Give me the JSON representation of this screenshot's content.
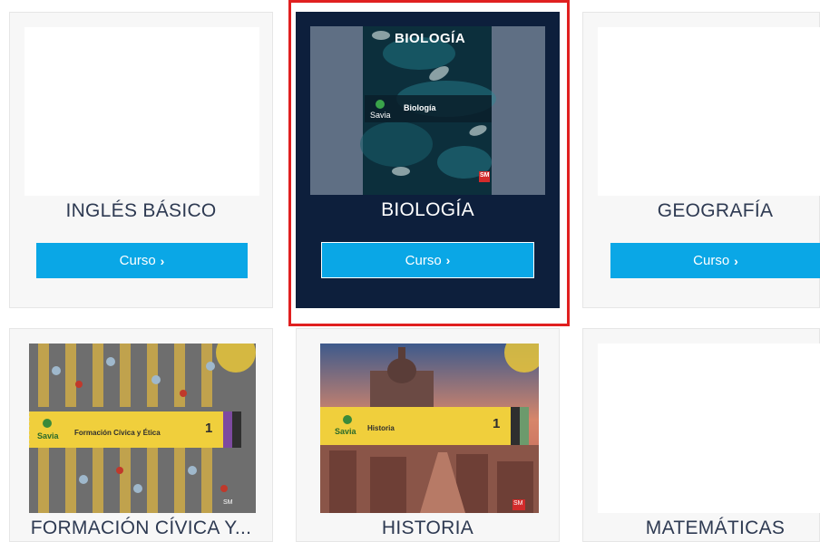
{
  "courses": [
    {
      "title": "INGLÉS BÁSICO",
      "button_label": "Curso",
      "button_icon": "chevron-right-icon"
    },
    {
      "title": "BIOLOGÍA",
      "button_label": "Curso",
      "button_icon": "chevron-right-icon",
      "cover": {
        "title": "BIOLOGÍA",
        "brand": "Savia",
        "subject": "Biología",
        "publisher": "SM"
      }
    },
    {
      "title": "GEOGRAFÍA",
      "button_label": "Curso",
      "button_icon": "chevron-right-icon"
    },
    {
      "title": "FORMACIÓN CÍVICA Y...",
      "cover": {
        "brand": "Savia",
        "subject": "Formación Cívica y Ética",
        "grade": "1",
        "publisher": "SM"
      }
    },
    {
      "title": "HISTORIA",
      "cover": {
        "brand": "Savia",
        "subject": "Historia",
        "grade": "1",
        "publisher": "SM"
      }
    },
    {
      "title": "MATEMÁTICAS"
    }
  ],
  "colors": {
    "button": "#0aa7e6",
    "selected_card": "#0d1f3c",
    "selection_outline": "#e02020",
    "title_text": "#2e3a52"
  }
}
